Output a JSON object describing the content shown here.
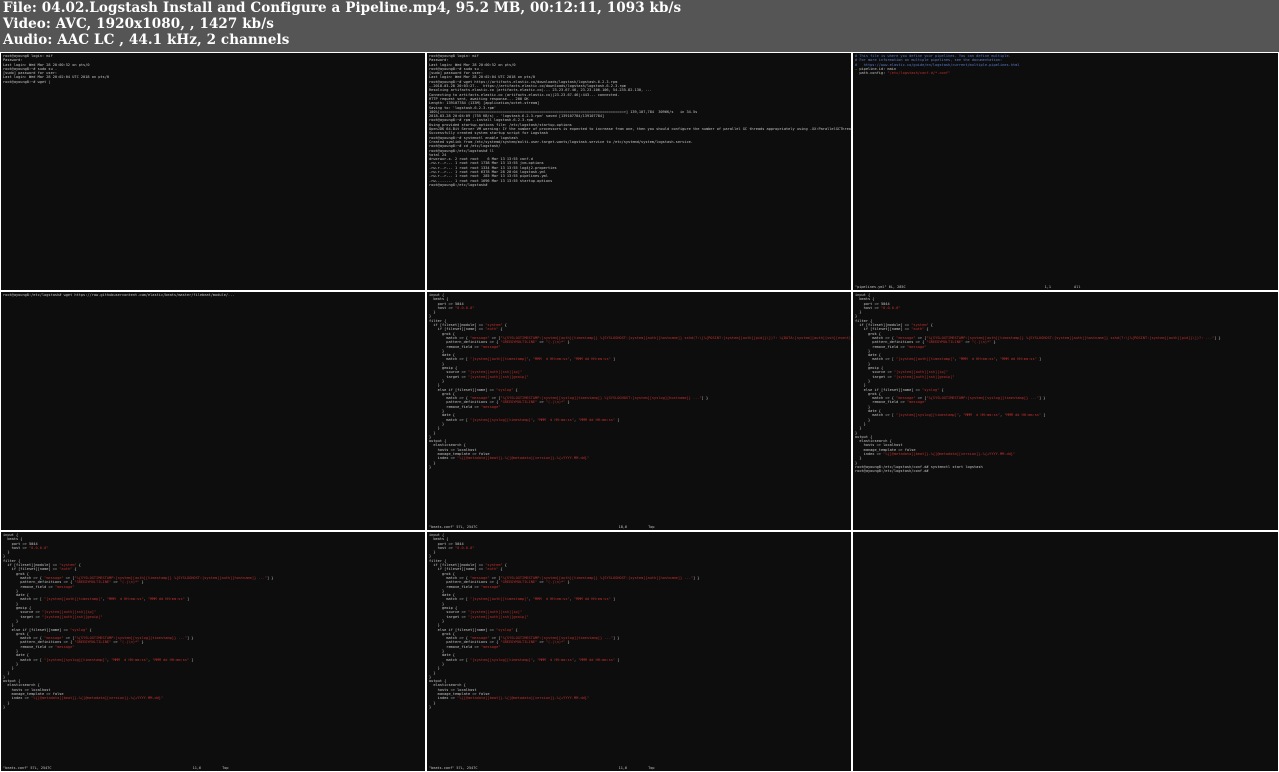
{
  "header": {
    "file_line": "File: 04.02.Logstash Install and Configure a Pipeline.mp4, 95.2 MB, 00:12:11, 1093 kb/s",
    "video_line": "Video: AVC, 1920x1080, , 1427 kb/s",
    "audio_line": "Audio: AAC LC , 44.1 kHz, 2 channels"
  },
  "colors": {
    "header_bg": "#555555",
    "header_text": "#ffffff",
    "terminal_bg": "#0d0d0d",
    "terminal_text": "#c8c8c8",
    "string_red": "#c0312d",
    "comment_blue": "#5a7fd0"
  },
  "thumbnails": [
    {
      "lines": [
        "root@ayoung8 login: mif",
        "Password:",
        "Last login: Wed Mar 28 20:00:52 on pts/0",
        "root@ayoung8:~# sudo su -",
        "[sudo] password for user:",
        "Last login: Wed Mar 28 20:02:04 UTC 2018 on pts/0",
        "root@ayoung8:~# wget |"
      ],
      "status": ""
    },
    {
      "lines": [
        "root@ayoung8 login: mif",
        "Password:",
        "Last login: Wed Mar 28 20:00:52 on pts/0",
        "root@ayoung8:~# sudo su -",
        "[sudo] password for user:",
        "Last login: Wed Mar 28 20:02:04 UTC 2018 on pts/0",
        "root@ayoung8:~# wget https://artifacts.elastic.co/downloads/logstash/logstash-6.2.3.rpm",
        "--2018-03-28 20:03:27--  https://artifacts.elastic.co/downloads/logstash/logstash-6.2.3.rpm",
        "Resolving artifacts.elastic.co (artifacts.elastic.co)... 23.23.67.46, 23.23.106.106, 54.235.82.130, ...",
        "Connecting to artifacts.elastic.co (artifacts.elastic.co)|23.23.67.46|:443... connected.",
        "HTTP request sent, awaiting response... 200 OK",
        "Length: 139107784 (133M) [application/octet-stream]",
        "Saving to: 'logstash-6.2.3.rpm'",
        "",
        "100%[=====================================================================================>] 139,107,784  3096K/s   in 34.5s",
        "",
        "2018-03-28 20:04:09 (755 KB/s) - 'logstash-6.2.3.rpm' saved [139107784/139107784]",
        "",
        "root@ayoung8:~# rpm --install logstash-6.2.3.rpm",
        "Using provided startup.options file: /etc/logstash/startup.options",
        "OpenJDK 64-Bit Server VM warning: If the number of processors is expected to increase from one, then you should configure the number of parallel GC threads appropriately using -XX:ParallelGCThreads=N",
        "Successfully created system startup script for Logstash",
        "root@ayoung8:~# systemctl enable logstash",
        "Created symlink from /etc/systemd/system/multi-user.target.wants/logstash.service to /etc/systemd/system/logstash.service.",
        "root@ayoung8:~# cd /etc/logstash/",
        "root@ayoung8:/etc/logstash# ll",
        "total 24",
        "drwxrwxr-x. 2 root root    6 Mar 13 13:55 conf.d",
        "-rw-r--r--. 1 root root 1738 Mar 13 13:55 jvm.options",
        "-rw-r--r--. 1 root root 1334 Mar 13 13:55 log4j2.properties",
        "-rw-r--r--. 1 root root 6378 Mar 28 20:04 logstash.yml",
        "-rw-r--r--. 1 root root  285 Mar 13 13:55 pipelines.yml",
        "-rw-------. 1 root root 1696 Mar 13 13:55 startup.options",
        "root@ayoung8:/etc/logstash# "
      ],
      "status": ""
    },
    {
      "lines": [
        "# This file is where you define your pipelines. You can define multiple.",
        "# For more information on multiple pipelines, see the documentation:",
        "#   https://www.elastic.co/guide/en/logstash/current/multiple-pipelines.html",
        "",
        "- pipeline.id: main",
        "  path.config: \"/etc/logstash/conf.d/*.conf\""
      ],
      "status": "\"pipelines.yml\" 6L, 285C                                                                  1,1           All"
    },
    {
      "lines": [
        "root@ayoung8:/etc/logstash# wget https://raw.githubusercontent.com/elastic/beats/master/filebeat/module/..."
      ],
      "status": ""
    },
    {
      "lines": [
        "input {",
        "  beats {",
        "    port => 5044",
        "    host => \"0.0.0.0\"",
        "  }",
        "}",
        "filter {",
        "  if [fileset][module] == \"system\" {",
        "    if [fileset][name] == \"auth\" {",
        "      grok {",
        "        match => { \"message\" => [\"%{SYSLOGTIMESTAMP:[system][auth][timestamp]} %{SYSLOGHOST:[system][auth][hostname]} sshd(?:\\[%{POSINT:[system][auth][pid]}\\])?: %{DATA:[system][auth][ssh][event]} ...\"] }",
        "        pattern_definitions => { \"GREEDYMULTILINE\" => \"(.|\\n)*\" }",
        "        remove_field => \"message\"",
        "      }",
        "      date {",
        "        match => [ \"[system][auth][timestamp]\", \"MMM  d HH:mm:ss\", \"MMM dd HH:mm:ss\" ]",
        "      }",
        "      geoip {",
        "        source => \"[system][auth][ssh][ip]\"",
        "        target => \"[system][auth][ssh][geoip]\"",
        "      }",
        "    }",
        "    else if [fileset][name] == \"syslog\" {",
        "      grok {",
        "        match => { \"message\" => [\"%{SYSLOGTIMESTAMP:[system][syslog][timestamp]} %{SYSLOGHOST:[system][syslog][hostname]} ...\"] }",
        "        pattern_definitions => { \"GREEDYMULTILINE\" => \"(.|\\n)*\" }",
        "        remove_field => \"message\"",
        "      }",
        "      date {",
        "        match => [ \"[system][syslog][timestamp]\", \"MMM  d HH:mm:ss\", \"MMM dd HH:mm:ss\" ]",
        "      }",
        "    }",
        "  }",
        "}",
        "output {",
        "  elasticsearch {",
        "    hosts => localhost",
        "    manage_template => false",
        "    index => \"%{[@metadata][beat]}-%{[@metadata][version]}-%{+YYYY.MM.dd}\"",
        "  }",
        "}"
      ],
      "status": "\"beats.conf\" 57L, 2547C                                                                   18,6          Top"
    },
    {
      "lines": [
        "input {",
        "  beats {",
        "    port => 5044",
        "    host => \"0.0.0.0\"",
        "  }",
        "}",
        "filter {",
        "  if [fileset][module] == \"system\" {",
        "    if [fileset][name] == \"auth\" {",
        "      grok {",
        "        match => { \"message\" => [\"%{SYSLOGTIMESTAMP:[system][auth][timestamp]} %{SYSLOGHOST:[system][auth][hostname]} sshd(?:\\[%{POSINT:[system][auth][pid]}\\])?: ...\"] }",
        "        pattern_definitions => { \"GREEDYMULTILINE\" => \"(.|\\n)*\" }",
        "        remove_field => \"message\"",
        "      }",
        "      date {",
        "        match => [ \"[system][auth][timestamp]\", \"MMM  d HH:mm:ss\", \"MMM dd HH:mm:ss\" ]",
        "      }",
        "      geoip {",
        "        source => \"[system][auth][ssh][ip]\"",
        "        target => \"[system][auth][ssh][geoip]\"",
        "      }",
        "    }",
        "    else if [fileset][name] == \"syslog\" {",
        "      grok {",
        "        match => { \"message\" => [\"%{SYSLOGTIMESTAMP:[system][syslog][timestamp]} ...\"] }",
        "        remove_field => \"message\"",
        "      }",
        "      date {",
        "        match => [ \"[system][syslog][timestamp]\", \"MMM  d HH:mm:ss\", \"MMM dd HH:mm:ss\" ]",
        "      }",
        "    }",
        "  }",
        "}",
        "output {",
        "  elasticsearch {",
        "    hosts => localhost",
        "    manage_template => false",
        "    index => \"%{[@metadata][beat]}-%{[@metadata][version]}-%{+YYYY.MM.dd}\"",
        "  }",
        "}",
        "root@ayoung8:/etc/logstash/conf.d# systemctl start logstash",
        "root@ayoung8:/etc/logstash/conf.d# "
      ],
      "status": ""
    },
    {
      "lines": [
        "input {",
        "  beats {",
        "    port => 5044",
        "    host => \"0.0.0.0\"",
        "  }",
        "}",
        "filter {",
        "  if [fileset][module] == \"system\" {",
        "    if [fileset][name] == \"auth\" {",
        "      grok {",
        "        match => { \"message\" => [\"%{SYSLOGTIMESTAMP:[system][auth][timestamp]} %{SYSLOGHOST:[system][auth][hostname]} ...\"] }",
        "        pattern_definitions => { \"GREEDYMULTILINE\" => \"(.|\\n)*\" }",
        "        remove_field => \"message\"",
        "      }",
        "      date {",
        "        match => [ \"[system][auth][timestamp]\", \"MMM  d HH:mm:ss\", \"MMM dd HH:mm:ss\" ]",
        "      }",
        "      geoip {",
        "        source => \"[system][auth][ssh][ip]\"",
        "        target => \"[system][auth][ssh][geoip]\"",
        "      }",
        "    }",
        "    else if [fileset][name] == \"syslog\" {",
        "      grok {",
        "        match => { \"message\" => [\"%{SYSLOGTIMESTAMP:[system][syslog][timestamp]} ...\"] }",
        "        pattern_definitions => { \"GREEDYMULTILINE\" => \"(.|\\n)*\" }",
        "        remove_field => \"message\"",
        "      }",
        "      date {",
        "        match => [ \"[system][syslog][timestamp]\", \"MMM  d HH:mm:ss\", \"MMM dd HH:mm:ss\" ]",
        "      }",
        "    }",
        "  }",
        "}",
        "output {",
        "  elasticsearch {",
        "    hosts => localhost",
        "    manage_template => false",
        "    index => \"%{[@metadata][beat]}-%{[@metadata][version]}-%{+YYYY.MM.dd}\"",
        "  }",
        "}"
      ],
      "status": "\"beats.conf\" 57L, 2547C                                                                   11,6          Top"
    },
    {
      "lines": [
        "input {",
        "  beats {",
        "    port => 5044",
        "    host => \"0.0.0.0\"",
        "  }",
        "}",
        "filter {",
        "  if [fileset][module] == \"system\" {",
        "    if [fileset][name] == \"auth\" {",
        "      grok {",
        "        match => { \"message\" => [\"%{SYSLOGTIMESTAMP:[system][auth][timestamp]} %{SYSLOGHOST:[system][auth][hostname]} ...\"] }",
        "        pattern_definitions => { \"GREEDYMULTILINE\" => \"(.|\\n)*\" }",
        "        remove_field => \"message\"",
        "      }",
        "      date {",
        "        match => [ \"[system][auth][timestamp]\", \"MMM  d HH:mm:ss\", \"MMM dd HH:mm:ss\" ]",
        "      }",
        "      geoip {",
        "        source => \"[system][auth][ssh][ip]\"",
        "        target => \"[system][auth][ssh][geoip]\"",
        "      }",
        "    }",
        "    else if [fileset][name] == \"syslog\" {",
        "      grok {",
        "        match => { \"message\" => [\"%{SYSLOGTIMESTAMP:[system][syslog][timestamp]} ...\"] }",
        "        pattern_definitions => { \"GREEDYMULTILINE\" => \"(.|\\n)*\" }",
        "        remove_field => \"message\"",
        "      }",
        "      date {",
        "        match => [ \"[system][syslog][timestamp]\", \"MMM  d HH:mm:ss\", \"MMM dd HH:mm:ss\" ]",
        "      }",
        "    }",
        "  }",
        "}",
        "output {",
        "  elasticsearch {",
        "    hosts => localhost",
        "    manage_template => false",
        "    index => \"%{[@metadata][beat]}-%{[@metadata][version]}-%{+YYYY.MM.dd}\"",
        "  }",
        "}"
      ],
      "status": "\"beats.conf\" 57L, 2547C                                                                   11,6          Top"
    },
    {
      "lines": [],
      "status": ""
    }
  ]
}
